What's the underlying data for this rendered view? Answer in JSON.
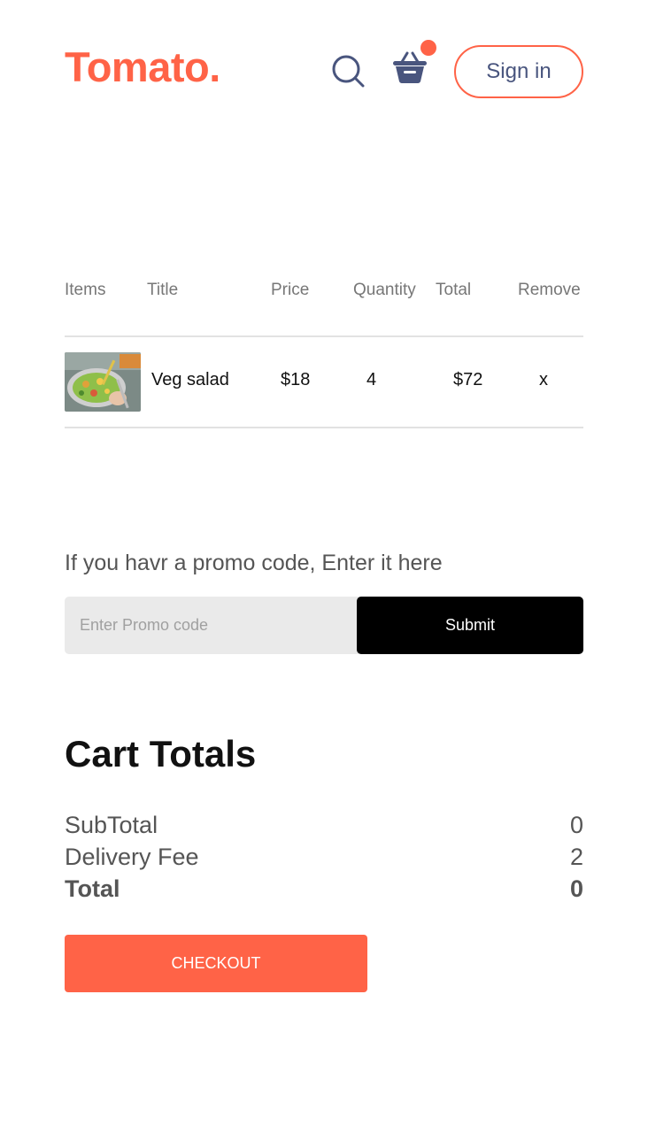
{
  "header": {
    "logo": "Tomato.",
    "search_icon": "search-icon",
    "basket_icon": "basket-icon",
    "signin_label": "Sign in"
  },
  "cart_table": {
    "columns": [
      "Items",
      "Title",
      "Price",
      "Quantity",
      "Total",
      "Remove"
    ],
    "rows": [
      {
        "image": "veg-salad-photo",
        "title": "Veg salad",
        "price": "$18",
        "quantity": "4",
        "total": "$72",
        "remove": "x"
      }
    ]
  },
  "promo": {
    "prompt": "If you havr a promo code, Enter it here",
    "placeholder": "Enter Promo code",
    "submit_label": "Submit"
  },
  "totals": {
    "title": "Cart Totals",
    "subtotal_label": "SubTotal",
    "subtotal_value": "0",
    "delivery_label": "Delivery Fee",
    "delivery_value": "2",
    "total_label": "Total",
    "total_value": "0",
    "checkout_label": "CHECKOUT"
  },
  "colors": {
    "brand": "#ff6347",
    "text_muted": "#555555",
    "nav_icon": "#49557e",
    "button_dark": "#000000"
  }
}
